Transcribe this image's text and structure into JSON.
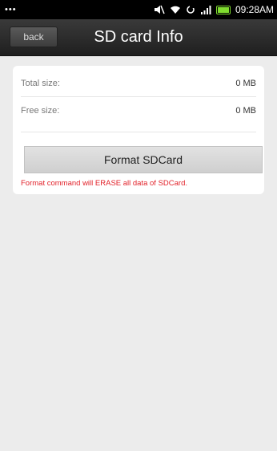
{
  "status_bar": {
    "left_dots": "•••",
    "time": "09:28AM",
    "icons": [
      "mute-icon",
      "wifi-icon",
      "sync-icon",
      "signal-icon",
      "battery-icon"
    ],
    "battery_color": "#7fdc2f"
  },
  "header": {
    "back_label": "back",
    "title": "SD card Info"
  },
  "sd_info": {
    "total_label": "Total size:",
    "total_value": "0 MB",
    "free_label": "Free size:",
    "free_value": "0 MB"
  },
  "actions": {
    "format_label": "Format SDCard",
    "warning_text": "Format command will ERASE all data of SDCard.",
    "warning_color": "#e2222a"
  }
}
